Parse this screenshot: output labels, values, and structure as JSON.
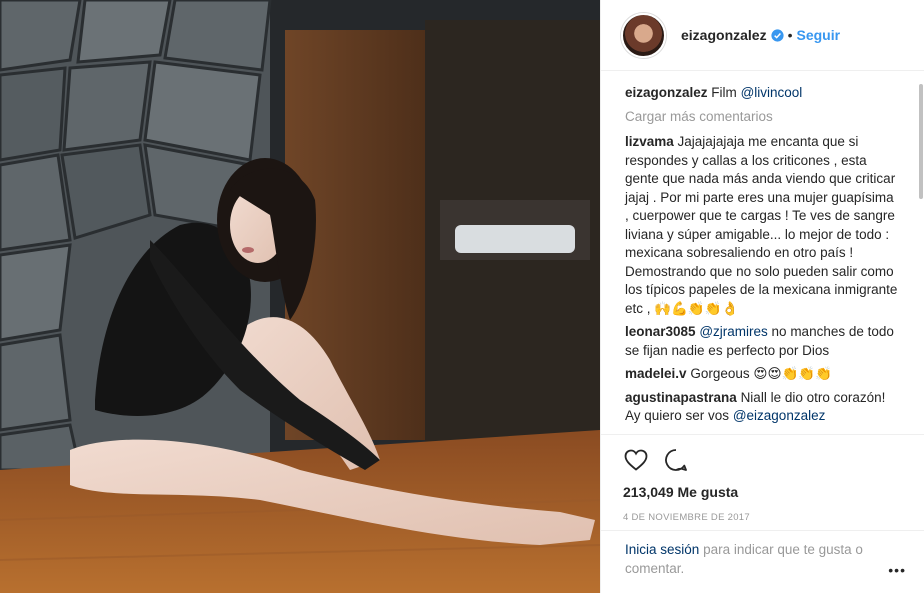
{
  "post": {
    "author": "eizagonzalez",
    "follow_label": "Seguir",
    "separator": "•",
    "caption_text": "Film",
    "caption_mention": "@livincool",
    "load_more": "Cargar más comentarios",
    "likes": "213,049 Me gusta",
    "date": "4 DE NOVIEMBRE DE 2017"
  },
  "comments": [
    {
      "user": "lizvama",
      "text": "Jajajajajaja me encanta que si responde​s y callas a los criticones , esta gente que nada más anda viendo que criticar jajaj . Por mi parte eres una mujer guapísima , cuerpower que te cargas ! Te ves de sangre liviana y súper amigable... lo mejor de todo : mexicana sobresaliendo en otro país ! Demostrando que no solo pueden salir como los típicos papeles de la mexicana inmigrante etc ,",
      "emoji": "🙌💪👏👏👌"
    },
    {
      "user": "leonar3085",
      "mention": "@zjramires",
      "text": "no manches de todo se fijan nadie es perfecto por Dios"
    },
    {
      "user": "madelei.v",
      "text": "Gorgeous",
      "emoji": "😍😍👏👏👏"
    },
    {
      "user": "agustinapastrana",
      "text": "Niall le dio otro corazón! Ay quiero ser vos",
      "mention": "@eizagonzalez"
    }
  ],
  "login": {
    "link": "Inicia sesión",
    "text": "para indicar que te gusta o comentar."
  },
  "more_label": "•••",
  "colors": {
    "accent": "#3897f0",
    "link": "#003569",
    "muted": "#999999"
  },
  "icons": [
    "heart-icon",
    "comment-icon",
    "verified-icon",
    "more-options-icon"
  ]
}
